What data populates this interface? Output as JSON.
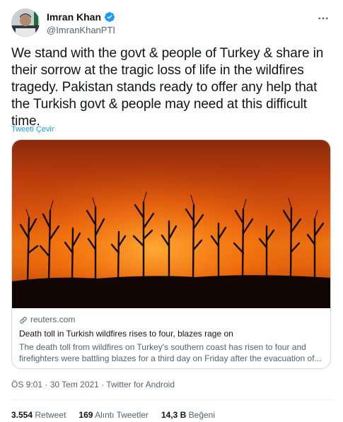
{
  "author": {
    "display_name": "Imran Khan",
    "handle": "@ImranKhanPTI",
    "verified": true
  },
  "tweet": {
    "text": "We stand with the govt & people of Turkey & share in their sorrow at the tragic loss of life in the wildfires tragedy. Pakistan stands ready to offer any help that the Turkish govt & people may need at this difficult time.",
    "translate_label": "Tweeti Çevir"
  },
  "card": {
    "domain": "reuters.com",
    "title": "Death toll in Turkish wildfires rises to four, blazes rage on",
    "description": "The death toll from wildfires on Turkey's southern coast has risen to four and firefighters were battling blazes for a third day on Friday after the evacuation of..."
  },
  "meta": {
    "timestamp": "ÖS 9:01 · 30 Tem 2021 · Twitter for Android"
  },
  "stats": {
    "retweets_count": "3.554",
    "retweets_label": "Retweet",
    "quotes_count": "169",
    "quotes_label": "Alıntı Tweetler",
    "likes_count": "14,3 B",
    "likes_label": "Beğeni"
  },
  "colors": {
    "accent": "#1d9bf0",
    "secondary_text": "#536471"
  }
}
